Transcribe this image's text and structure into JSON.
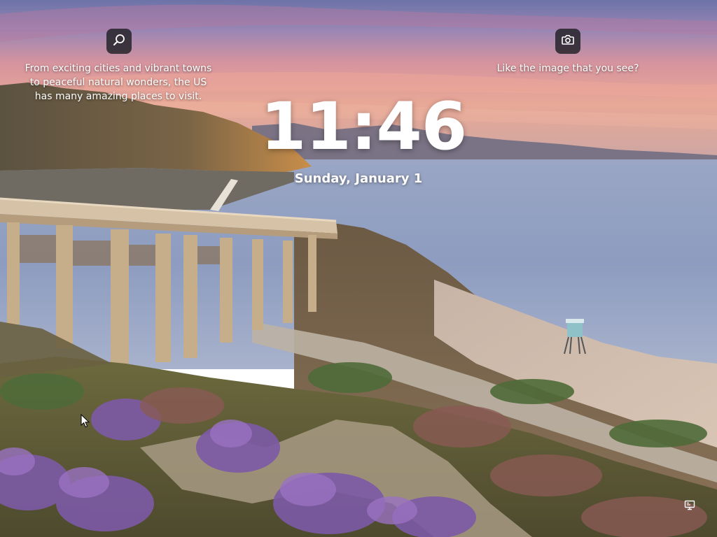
{
  "screen": "lock-screen",
  "spotlight": {
    "left_icon": "search-icon",
    "description": "From exciting cities and vibrant towns to peaceful natural wonders, the US has many amazing places to visit.",
    "right_icon": "camera-icon",
    "like_prompt": "Like the image that you see?"
  },
  "clock": {
    "time": "11:46",
    "date": "Sunday, January 1"
  },
  "status": {
    "network_icon": "ethernet-icon"
  },
  "colors": {
    "text": "#ffffff",
    "button_bg": "#202024"
  }
}
